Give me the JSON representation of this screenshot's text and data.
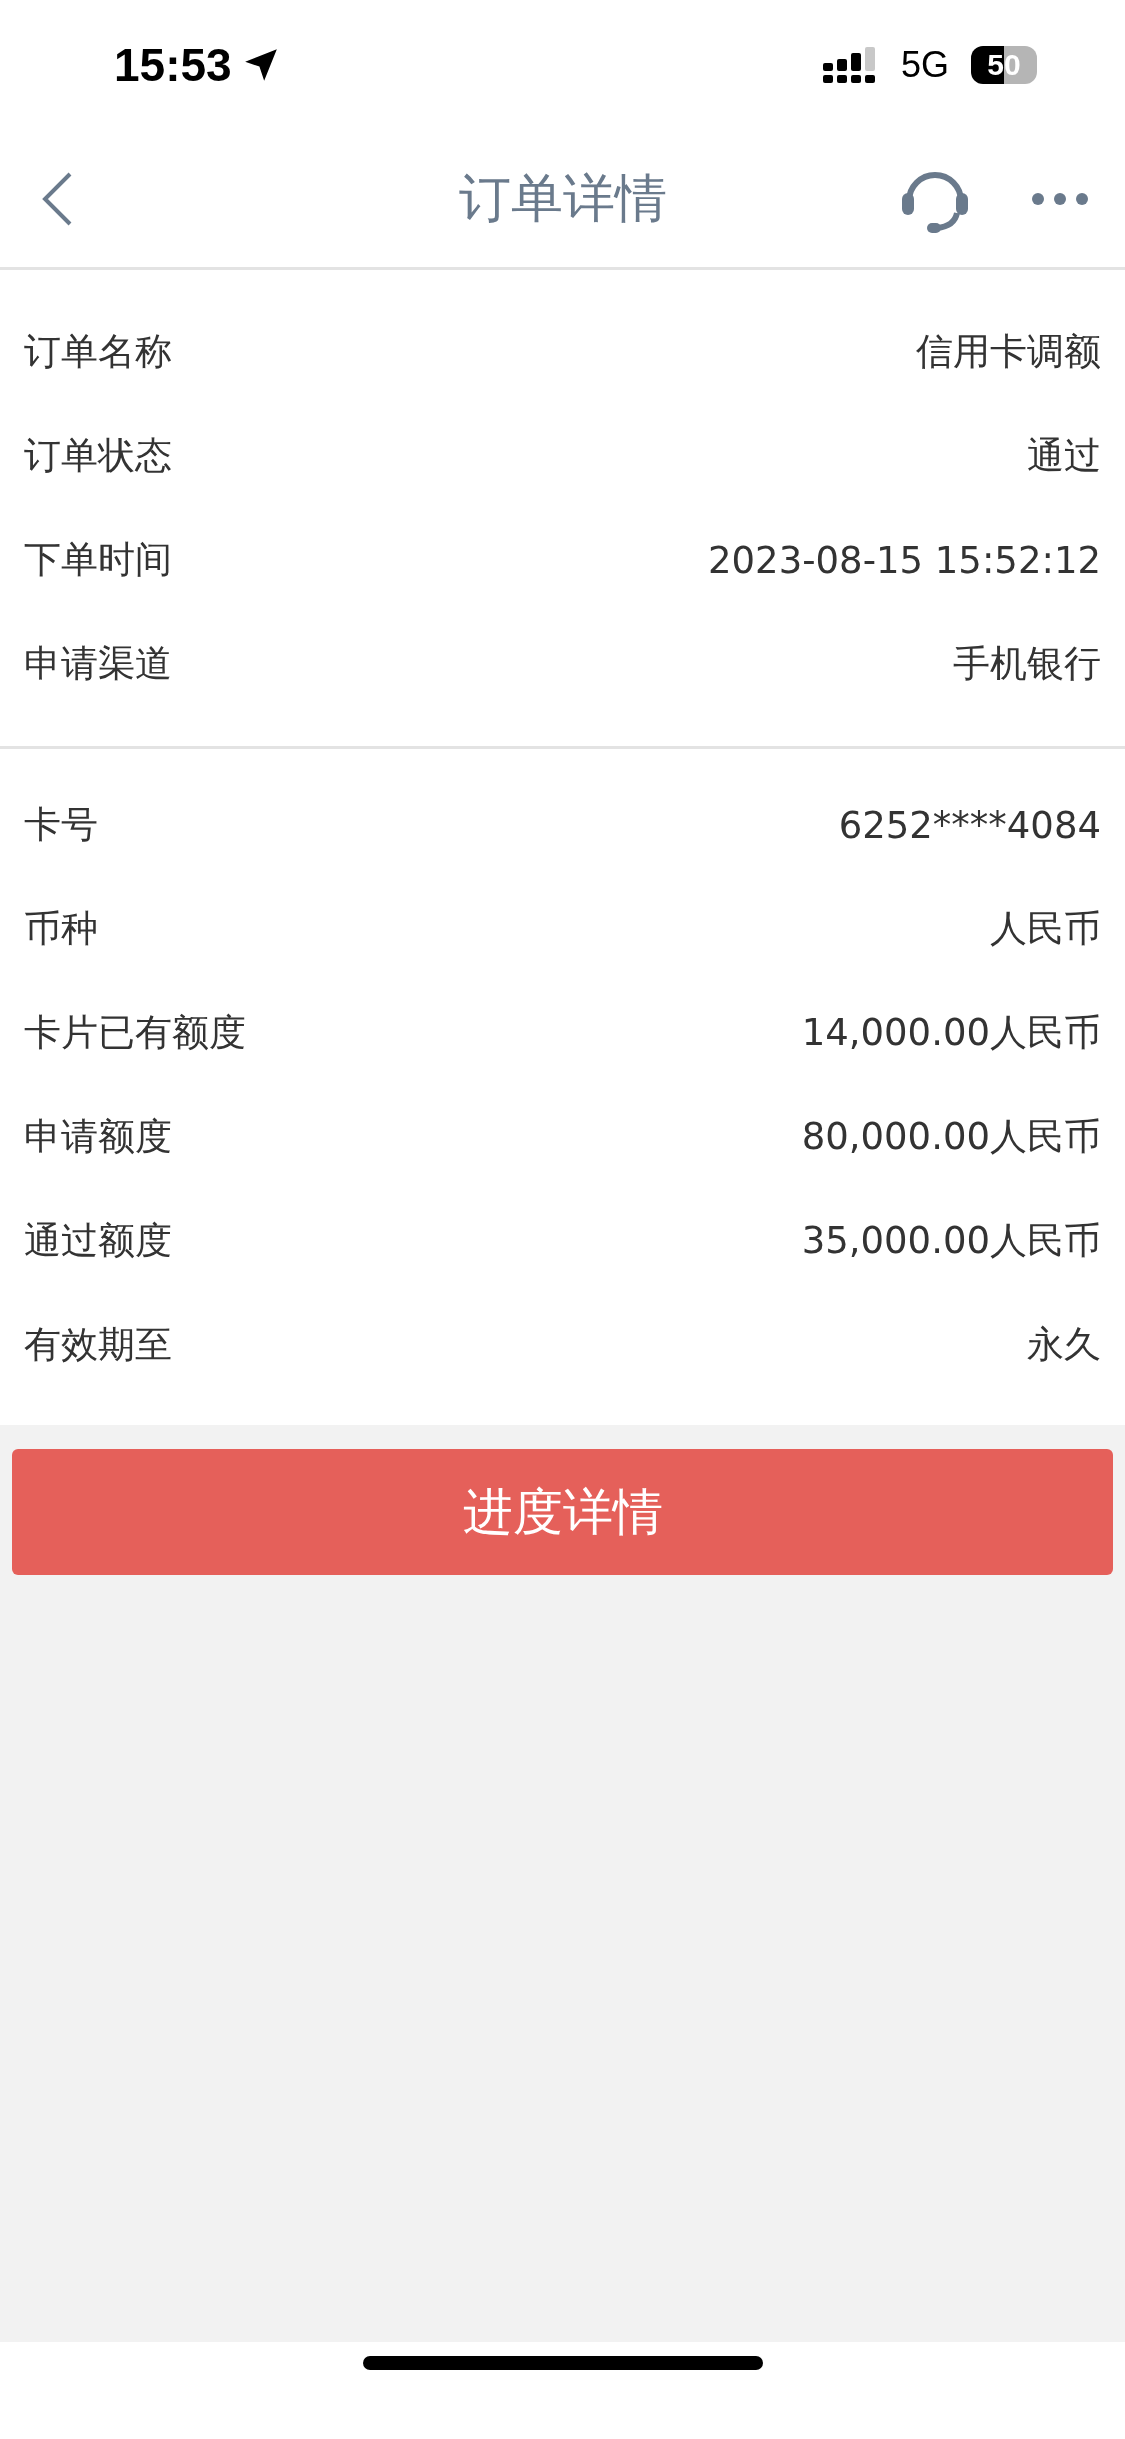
{
  "status_bar": {
    "time": "15:53",
    "network": "5G",
    "battery": "50"
  },
  "header": {
    "title": "订单详情"
  },
  "sections": [
    {
      "rows": [
        {
          "label": "订单名称",
          "value": "信用卡调额"
        },
        {
          "label": "订单状态",
          "value": "通过"
        },
        {
          "label": "下单时间",
          "value": "2023-08-15 15:52:12"
        },
        {
          "label": "申请渠道",
          "value": "手机银行"
        }
      ]
    },
    {
      "rows": [
        {
          "label": "卡号",
          "value": "6252****4084"
        },
        {
          "label": "币种",
          "value": "人民币"
        },
        {
          "label": "卡片已有额度",
          "value": "14,000.00人民币"
        },
        {
          "label": "申请额度",
          "value": "80,000.00人民币"
        },
        {
          "label": "通过额度",
          "value": "35,000.00人民币"
        },
        {
          "label": "有效期至",
          "value": "永久"
        }
      ]
    }
  ],
  "action_button": "进度详情"
}
